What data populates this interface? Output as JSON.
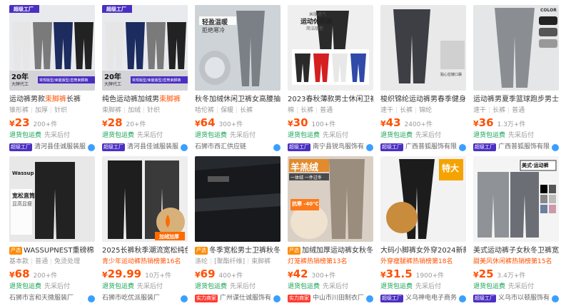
{
  "products": [
    {
      "title_pre": "运动裤男款",
      "title_hl": "束脚裤",
      "title_post": "长裤",
      "badge": "",
      "badge_color": "",
      "tags": [
        "锥形裤",
        "加厚",
        "针织"
      ],
      "sub": "",
      "price": "23",
      "sold": "200+件",
      "svc1": "退货包运费",
      "svc2": "先采后付",
      "shop_badge": "超级工厂",
      "shop_badge_type": "factory",
      "shop": "清河县佳诚服装服",
      "img": {
        "bg": "#d8d8dc",
        "colors": [
          "#e6e6e6",
          "#7a7a7a",
          "#1c2c5e",
          "#222222"
        ],
        "logo": "超级工厂",
        "year": "20年",
        "yearsub": "大牌代工",
        "banner": "常规版型/束腿版型/直筒束脚裤",
        "kind": "pants4"
      }
    },
    {
      "title_pre": "纯色运动裤加绒男",
      "title_hl": "束脚裤",
      "title_post": "",
      "badge": "",
      "badge_color": "",
      "tags": [
        "束脚裤",
        "加绒",
        "针织"
      ],
      "sub": "",
      "price": "28",
      "sold": "20+件",
      "svc1": "退货包运费",
      "svc2": "先采后付",
      "shop_badge": "超级工厂",
      "shop_badge_type": "factory",
      "shop": "清河县佳诚服装服",
      "img": {
        "bg": "#d8d8dc",
        "colors": [
          "#e6e6e6",
          "#1c2c5e",
          "#7a7a7a",
          "#222222"
        ],
        "logo": "超级工厂",
        "year": "20年",
        "yearsub": "大牌代工",
        "banner": "常规版型/束腿版型/直筒束脚裤",
        "kind": "pants4"
      }
    },
    {
      "title_pre": "秋冬加绒休闲卫裤女高腰抽",
      "title_hl": "",
      "title_post": "",
      "badge": "",
      "badge_color": "",
      "tags": [
        "哈伦裤",
        "保暖",
        "长裤"
      ],
      "sub": "",
      "price": "64",
      "sold": "300+件",
      "svc1": "退货包运费",
      "svc2": "先采后付",
      "shop_badge": "",
      "shop_badge_type": "",
      "shop": "石狮市西汇供应链",
      "img": {
        "bg": "#c9cfd4",
        "line1": "轻盈温暖",
        "line2": "拒绝寒冷",
        "kind": "jogger"
      }
    },
    {
      "title_pre": "2023春秋薄款男士休闲卫裤",
      "title_hl": "",
      "title_post": "",
      "badge": "",
      "badge_color": "",
      "tags": [
        "棉",
        "长裤",
        "普通"
      ],
      "sub": "",
      "price": "30",
      "sold": "100+件",
      "svc1": "退货包运费",
      "svc2": "先采后付",
      "shop_badge": "超级工厂",
      "shop_badge_type": "factory",
      "shop": "南宁县锐鸟服饰有",
      "img": {
        "bg": "#efefef",
        "line1": "米肤透气",
        "line2": "运动休闲裤",
        "line3": "简洁版型",
        "kind": "sweat"
      }
    },
    {
      "title_pre": "梭织锦纶运动裤男春季健身",
      "title_hl": "",
      "title_post": "",
      "badge": "",
      "badge_color": "",
      "tags": [
        "速干",
        "长裤",
        "锦纶"
      ],
      "sub": "",
      "price": "43",
      "sold": "2400+件",
      "svc1": "退货包运费",
      "svc2": "先采后付",
      "shop_badge": "超级工厂",
      "shop_badge_type": "factory",
      "shop": "广西普狐服饰有限",
      "img": {
        "bg": "#e9e9e9",
        "caption": "贴心拉链口袋",
        "kind": "dark"
      }
    },
    {
      "title_pre": "运动裤男夏季篮球跑步男士",
      "title_hl": "",
      "title_post": "",
      "badge": "",
      "badge_color": "",
      "tags": [
        "速干",
        "长裤",
        "普通"
      ],
      "sub": "",
      "price": "36",
      "sold": "1.3万+件",
      "svc1": "退货包运费",
      "svc2": "先采后付",
      "shop_badge": "超级工厂",
      "shop_badge_type": "factory",
      "shop": "广西普狐服饰有限",
      "img": {
        "bg": "#e5e6e8",
        "caption": "COLOR",
        "kind": "grey"
      }
    },
    {
      "title_pre": "WASSUPNEST重磅棉",
      "title_hl": "",
      "title_post": "",
      "badge": "严选",
      "badge_color": "orange",
      "tags": [
        "基本款",
        "普通",
        "免烫处理"
      ],
      "sub": "",
      "price": "68",
      "sold": "200+件",
      "svc1": "退货包运费",
      "svc2": "先采后付",
      "shop_badge": "",
      "shop_badge_type": "",
      "shop": "石狮市言和天微服装厂",
      "img": {
        "bg": "#e8e8e8",
        "line1": "Wassup",
        "line2": "宽松直筒",
        "line3": "显高显瘦",
        "kind": "wide"
      }
    },
    {
      "title_pre": "2025长裤秋季潮流宽松纯色",
      "title_hl": "",
      "title_post": "",
      "badge": "",
      "badge_color": "",
      "tags": [],
      "sub": "青少年运动裤热销榜第16名",
      "price": "29.99",
      "sold": "10万+件",
      "svc1": "退货包运费",
      "svc2": "先采后付",
      "shop_badge": "",
      "shop_badge_type": "",
      "shop": "石狮市屹优派服装厂",
      "img": {
        "bg": "#eeeeee",
        "caption": "加绒加厚",
        "kind": "fleece"
      }
    },
    {
      "title_pre": "冬季宽松男士卫裤秋冬",
      "title_hl": "",
      "title_post": "",
      "badge": "严选",
      "badge_color": "orange",
      "tags": [
        "涤纶",
        "[聚酯纤维]",
        "束脚裤"
      ],
      "sub": "",
      "price": "69",
      "sold": "400+件",
      "svc1": "退货包运费",
      "svc2": "先采后付",
      "shop_badge": "实力商家",
      "shop_badge_type": "power",
      "shop": "广州谋仕诚服饰有",
      "img": {
        "bg": "#262a2e",
        "kind": "fabric"
      }
    },
    {
      "title_pre": "加绒加厚运动裤女秋冬",
      "title_hl": "",
      "title_post": "",
      "badge": "严选",
      "badge_color": "orange",
      "tags": [],
      "sub": "灯笼裤热销榜第13名",
      "price": "42",
      "sold": "300+件",
      "svc1": "退货包运费",
      "svc2": "先采后付",
      "shop_badge": "实力商家",
      "shop_badge_type": "power",
      "shop": "中山市川田制衣厂",
      "img": {
        "bg": "#d9cfc4",
        "line1": "羊羔绒",
        "line2": "一体绒 一件过冬",
        "line3": "抗寒 -40℃",
        "kind": "lamb"
      }
    },
    {
      "title_pre": "大码小脚裤女外穿2024新款",
      "title_hl": "",
      "title_post": "",
      "badge": "",
      "badge_color": "",
      "tags": [],
      "sub": "外穿瘦腿裤热销榜第18名",
      "price": "31.5",
      "sold": "1900+件",
      "svc1": "退货包运费",
      "svc2": "先采后付",
      "shop_badge": "超级工厂",
      "shop_badge_type": "factory",
      "shop": "义乌神电电子商务",
      "img": {
        "bg": "#f2f2f2",
        "line1": "特大",
        "kind": "tights"
      }
    },
    {
      "title_pre": "美式运动裤子女秋冬卫裤宽",
      "title_hl": "",
      "title_post": "",
      "badge": "",
      "badge_color": "",
      "tags": [],
      "sub": "甜美风休闲裤热销榜第15名",
      "price": "25",
      "sold": "3.4万+件",
      "svc1": "退货包运费",
      "svc2": "先采后付",
      "shop_badge": "超级工厂",
      "shop_badge_type": "factory",
      "shop": "义乌市以顿服饰有",
      "img": {
        "bg": "#f0f0f0",
        "line1": "美式·运动裤",
        "kind": "wide-grey"
      }
    }
  ],
  "currency": "¥"
}
